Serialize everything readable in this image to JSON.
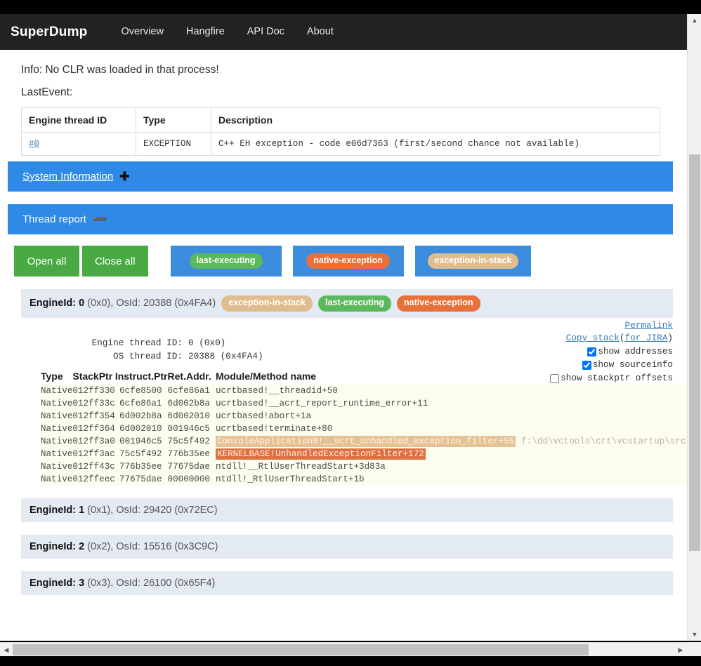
{
  "navbar": {
    "brand": "SuperDump",
    "links": [
      {
        "label": "Overview"
      },
      {
        "label": "Hangfire"
      },
      {
        "label": "API Doc"
      },
      {
        "label": "About"
      }
    ]
  },
  "info": {
    "clr_notice": "Info: No CLR was loaded in that process!",
    "lastevent_label": "LastEvent:"
  },
  "lastevent_table": {
    "headers": [
      "Engine thread ID",
      "Type",
      "Description"
    ],
    "rows": [
      {
        "engine_thread_id": "#0",
        "type": "EXCEPTION",
        "description": "C++ EH exception - code e06d7363 (first/second chance not available)"
      }
    ]
  },
  "panels": {
    "system_information": {
      "title": "System Information",
      "toggle_icon": "plus-icon",
      "toggle_glyph": "✚"
    },
    "thread_report": {
      "title": "Thread report",
      "toggle_icon": "minus-icon",
      "toggle_glyph": "➖"
    }
  },
  "toolbar": {
    "open_all": "Open all",
    "close_all": "Close all",
    "filters": [
      {
        "label": "last-executing",
        "style": "green"
      },
      {
        "label": "native-exception",
        "style": "orange"
      },
      {
        "label": "exception-in-stack",
        "style": "tan"
      }
    ]
  },
  "threads": [
    {
      "label_prefix": "EngineId:",
      "engine_id": "0",
      "engine_hex": "(0x0),",
      "os_label": "OsId:",
      "os_id": "20388",
      "os_hex": "(0x4FA4)",
      "tags": [
        {
          "label": "exception-in-stack",
          "style": "tan"
        },
        {
          "label": "last-executing",
          "style": "green"
        },
        {
          "label": "native-exception",
          "style": "orange"
        }
      ]
    },
    {
      "label_prefix": "EngineId:",
      "engine_id": "1",
      "engine_hex": "(0x1),",
      "os_label": "OsId:",
      "os_id": "29420",
      "os_hex": "(0x72EC)",
      "tags": []
    },
    {
      "label_prefix": "EngineId:",
      "engine_id": "2",
      "engine_hex": "(0x2),",
      "os_label": "OsId:",
      "os_id": "15516",
      "os_hex": "(0x3C9C)",
      "tags": []
    },
    {
      "label_prefix": "EngineId:",
      "engine_id": "3",
      "engine_hex": "(0x3),",
      "os_label": "OsId:",
      "os_id": "26100",
      "os_hex": "(0x65F4)",
      "tags": []
    }
  ],
  "thread_detail": {
    "engine_thread_id_label": "Engine thread ID:",
    "engine_thread_id_value": "0  (0x0)",
    "os_thread_id_label": "OS thread ID:",
    "os_thread_id_value": "20388  (0x4FA4)",
    "permalink": "Permalink",
    "copy_stack": "Copy stack",
    "for_jira_open": "(",
    "for_jira": "for JIRA",
    "for_jira_close": ")",
    "checkboxes": [
      {
        "label": "show addresses",
        "checked": true
      },
      {
        "label": "show sourceinfo",
        "checked": true
      },
      {
        "label": "show stackptr offsets",
        "checked": false
      }
    ]
  },
  "stack_table": {
    "headers": [
      "Type",
      "StackPtr",
      "Instruct.Ptr",
      "Ret.Addr.",
      "Module/Method name"
    ],
    "rows": [
      {
        "type": "Native",
        "stackptr": "012ff330",
        "instructptr": "6cfe8500",
        "retaddr": "6cfe86a1",
        "module": "ucrtbased!__threadid+50",
        "highlight": "none",
        "sourceinfo": ""
      },
      {
        "type": "Native",
        "stackptr": "012ff33c",
        "instructptr": "6cfe86a1",
        "retaddr": "6d002b8a",
        "module": "ucrtbased!__acrt_report_runtime_error+11",
        "highlight": "none",
        "sourceinfo": ""
      },
      {
        "type": "Native",
        "stackptr": "012ff354",
        "instructptr": "6d002b8a",
        "retaddr": "6d002010",
        "module": "ucrtbased!abort+1a",
        "highlight": "none",
        "sourceinfo": ""
      },
      {
        "type": "Native",
        "stackptr": "012ff364",
        "instructptr": "6d002010",
        "retaddr": "001946c5",
        "module": "ucrtbased!terminate+80",
        "highlight": "none",
        "sourceinfo": ""
      },
      {
        "type": "Native",
        "stackptr": "012ff3a0",
        "instructptr": "001946c5",
        "retaddr": "75c5f492",
        "module": "ConsoleApplication8!__scrt_unhandled_exception_filter+55",
        "highlight": "tan",
        "sourceinfo": "f:\\dd\\vctools\\crt\\vcstartup\\src\\utility"
      },
      {
        "type": "Native",
        "stackptr": "012ff3ac",
        "instructptr": "75c5f492",
        "retaddr": "776b35ee",
        "module": "KERNELBASE!UnhandledExceptionFilter+172",
        "highlight": "orange",
        "sourceinfo": ""
      },
      {
        "type": "Native",
        "stackptr": "012ff43c",
        "instructptr": "776b35ee",
        "retaddr": "77675dae",
        "module": "ntdll!__RtlUserThreadStart+3d83a",
        "highlight": "none",
        "sourceinfo": ""
      },
      {
        "type": "Native",
        "stackptr": "012ffeec",
        "instructptr": "77675dae",
        "retaddr": "00000000",
        "module": "ntdll!_RtlUserThreadStart+1b",
        "highlight": "none",
        "sourceinfo": ""
      }
    ]
  },
  "scrollbars": {
    "vertical_up": "▲",
    "vertical_down": "▼",
    "horizontal_left": "◀",
    "horizontal_right": "▶"
  },
  "colors": {
    "navbar_bg": "#222222",
    "panel_blue": "#2e8ae6",
    "button_green": "#49a942",
    "button_blue": "#3c8dde",
    "badge_green": "#5cb85c",
    "badge_orange": "#e8703a",
    "badge_tan": "#e0bd8e",
    "thread_row_bg": "#e4eaf2",
    "stack_bg": "#fdfdef",
    "link_blue": "#337ab7"
  }
}
